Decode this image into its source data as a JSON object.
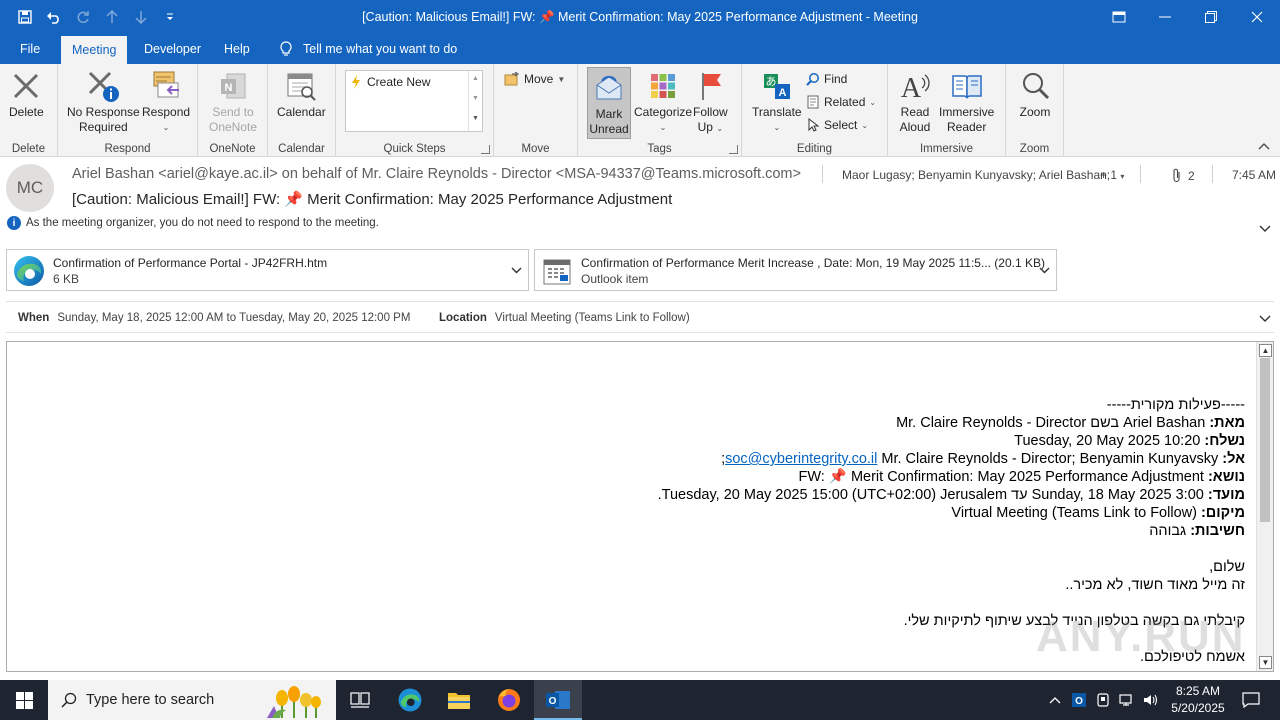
{
  "window": {
    "title": "[Caution: Malicious Email!] FW: 📌 Merit Confirmation: May 2025 Performance Adjustment  -  Meeting"
  },
  "tabs": [
    "File",
    "Meeting",
    "Developer",
    "Help"
  ],
  "tell_me": "Tell me what you want to do",
  "ribbon": {
    "delete": {
      "label": "Delete",
      "group": "Delete"
    },
    "respond": {
      "no_response_1": "No Response",
      "no_response_2": "Required",
      "respond": "Respond",
      "group": "Respond"
    },
    "onenote": {
      "send_1": "Send to",
      "send_2": "OneNote",
      "group": "OneNote"
    },
    "calendar": {
      "label": "Calendar",
      "group": "Calendar"
    },
    "quicksteps": {
      "create_new": "Create New",
      "group": "Quick Steps"
    },
    "move": {
      "label": "Move",
      "group": "Move"
    },
    "tags": {
      "mark_1": "Mark",
      "mark_2": "Unread",
      "categorize": "Categorize",
      "follow_1": "Follow",
      "follow_2": "Up",
      "group": "Tags"
    },
    "editing": {
      "translate": "Translate",
      "find": "Find",
      "related": "Related",
      "select": "Select",
      "group": "Editing"
    },
    "immersive": {
      "read_1": "Read",
      "read_2": "Aloud",
      "reader_1": "Immersive",
      "reader_2": "Reader",
      "group": "Immersive"
    },
    "zoom": {
      "label": "Zoom",
      "group": "Zoom"
    }
  },
  "header": {
    "avatar_initials": "MC",
    "from": "Ariel Bashan <ariel@kaye.ac.il> on behalf of Mr. Claire Reynolds - Director <MSA-94337@Teams.microsoft.com>",
    "subject": "[Caution: Malicious Email!] FW: 📌 Merit Confirmation: May 2025 Performance Adjustment",
    "to": "Maor Lugasy; Benyamin Kunyavsky; Ariel Bashan;",
    "more_recipients": "+ 1",
    "attachment_count": "2",
    "time": "7:45 AM",
    "info": "As the meeting organizer, you do not need to respond to the meeting."
  },
  "attachments": [
    {
      "name": "Confirmation of Performance Portal - JP42FRH.htm",
      "size": "6 KB"
    },
    {
      "name": "Confirmation of Performance Merit Increase , Date: Mon, 19 May 2025 11:5... (20.1 KB)",
      "size": "Outlook item"
    }
  ],
  "meeting": {
    "when_label": "When",
    "when": "Sunday, May 18, 2025 12:00 AM to Tuesday, May 20, 2025 12:00 PM",
    "location_label": "Location",
    "location": "Virtual Meeting (Teams Link to Follow)"
  },
  "body": {
    "l1": "-----פעילות מקורית-----",
    "from_label": "מאת:",
    "from_value": "Ariel Bashan בשם Mr. Claire Reynolds - Director",
    "sent_label": "נשלח:",
    "sent_value": "Tuesday, 20 May 2025 10:20",
    "to_label": "אל:",
    "to_value": "Mr. Claire Reynolds - Director; Benyamin Kunyavsky;",
    "to_link": "soc@cyberintegrity.co.il",
    "subject_label": "נושא:",
    "subject_value": "FW: 📌 Merit Confirmation: May 2025 Performance Adjustment",
    "when_label": "מועד:",
    "when_value": "Sunday, 18 May 2025 3:00 עד Tuesday, 20 May 2025 15:00 (UTC+02:00) Jerusalem.",
    "location_label": "מיקום:",
    "location_value": "Virtual Meeting (Teams Link to Follow)",
    "importance_label": "חשיבות:",
    "importance_value": "גבוהה",
    "greeting": "שלום,",
    "p1": "זה מייל מאוד חשוד, לא מכיר..",
    "p2": "קיבלתי גם בקשה בטלפון הנייד לבצע שיתוף לתיקיות שלי.",
    "p3": "אשמח לטיפולכם."
  },
  "watermark": "ANY.RUN",
  "taskbar": {
    "search_placeholder": "Type here to search",
    "time": "8:25 AM",
    "date": "5/20/2025"
  },
  "colors": {
    "accent": "#1565c0",
    "ribbon_bg": "#f3f3f3",
    "taskbar": "#1f2530",
    "link": "#0563c1"
  }
}
